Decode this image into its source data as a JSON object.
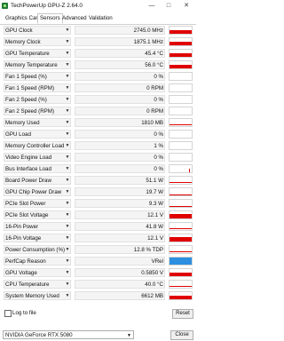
{
  "window": {
    "title": "TechPowerUp GPU-Z 2.64.0",
    "minimize": "—",
    "maximize": "□",
    "close": "✕"
  },
  "tabs": [
    "Graphics Card",
    "Sensors",
    "Advanced",
    "Validation"
  ],
  "active_tab": "Sensors",
  "sensors": [
    {
      "label": "GPU Clock",
      "value": "2745.0 MHz",
      "graph": "bar",
      "level": 0.5,
      "color": "#e00000"
    },
    {
      "label": "Memory Clock",
      "value": "1875.1 MHz",
      "graph": "bar",
      "level": 0.5,
      "color": "#e00000"
    },
    {
      "label": "GPU Temperature",
      "value": "45.4 °C",
      "graph": "bar",
      "level": 0.45,
      "color": "#e00000"
    },
    {
      "label": "Memory Temperature",
      "value": "56.0 °C",
      "graph": "bar",
      "level": 0.55,
      "color": "#e00000"
    },
    {
      "label": "Fan 1 Speed (%)",
      "value": "0 %",
      "graph": "none"
    },
    {
      "label": "Fan 1 Speed (RPM)",
      "value": "0 RPM",
      "graph": "none"
    },
    {
      "label": "Fan 2 Speed (%)",
      "value": "0 %",
      "graph": "none"
    },
    {
      "label": "Fan 2 Speed (RPM)",
      "value": "0 RPM",
      "graph": "none"
    },
    {
      "label": "Memory Used",
      "value": "1810 MB",
      "graph": "line",
      "level": 0.08,
      "color": "#e00000"
    },
    {
      "label": "GPU Load",
      "value": "0 %",
      "graph": "none"
    },
    {
      "label": "Memory Controller Load",
      "value": "1 %",
      "graph": "none"
    },
    {
      "label": "Video Engine Load",
      "value": "0 %",
      "graph": "none"
    },
    {
      "label": "Bus Interface Load",
      "value": "0 %",
      "graph": "spike",
      "level": 0.5,
      "color": "#e00000"
    },
    {
      "label": "Board Power Draw",
      "value": "51.1 W",
      "graph": "line",
      "level": 0.1,
      "color": "#e00000"
    },
    {
      "label": "GPU Chip Power Draw",
      "value": "19.7 W",
      "graph": "line",
      "level": 0.06,
      "color": "#e00000"
    },
    {
      "label": "PCIe Slot Power",
      "value": "9.3 W",
      "graph": "line",
      "level": 0.06,
      "color": "#e00000"
    },
    {
      "label": "PCIe Slot Voltage",
      "value": "12.1 V",
      "graph": "bar",
      "level": 0.6,
      "color": "#e00000"
    },
    {
      "label": "16-Pin Power",
      "value": "41.8 W",
      "graph": "line",
      "level": 0.1,
      "color": "#e00000"
    },
    {
      "label": "16-Pin Voltage",
      "value": "12.1 V",
      "graph": "bar",
      "level": 0.6,
      "color": "#e00000"
    },
    {
      "label": "Power Consumption (%)",
      "value": "12.8 % TDP",
      "graph": "line",
      "level": 0.1,
      "color": "#e00000"
    },
    {
      "label": "PerfCap Reason",
      "value": "VRel",
      "graph": "bar",
      "level": 1.0,
      "color": "#2e8fe0"
    },
    {
      "label": "GPU Voltage",
      "value": "0.5850 V",
      "graph": "bar",
      "level": 0.45,
      "color": "#e00000"
    },
    {
      "label": "CPU Temperature",
      "value": "40.0 °C",
      "graph": "line",
      "level": 0.08,
      "color": "#e00000"
    },
    {
      "label": "System Memory Used",
      "value": "6612 MB",
      "graph": "bar",
      "level": 0.5,
      "color": "#e00000"
    }
  ],
  "log_to_file": {
    "label": "Log to file",
    "checked": false
  },
  "reset_label": "Reset",
  "close_label": "Close",
  "gpu_select": {
    "value": "NVIDIA GeForce RTX 5080"
  }
}
